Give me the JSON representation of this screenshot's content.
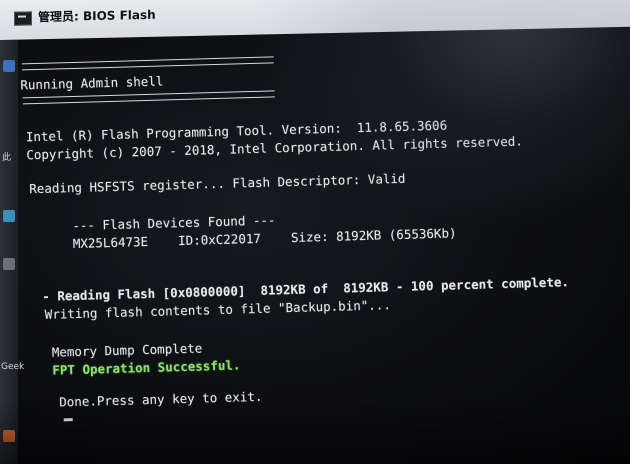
{
  "window": {
    "title": "管理员: BIOS Flash"
  },
  "sidebar": {
    "char_1": "此",
    "label_geek": "Geek"
  },
  "terminal": {
    "header": "Running Admin shell",
    "tool_line": "Intel (R) Flash Programming Tool. Version:  11.8.65.3606",
    "copyright_line": "Copyright (c) 2007 - 2018, Intel Corporation. All rights reserved.",
    "hsfsts_line": "Reading HSFSTS register... Flash Descriptor: Valid",
    "devices_header": "--- Flash Devices Found ---",
    "device_line": "MX25L6473E    ID:0xC22017    Size: 8192KB (65536Kb)",
    "reading_line": "- Reading Flash [0x0800000]  8192KB of  8192KB - 100 percent complete.",
    "writing_line": "Writing flash contents to file \"Backup.bin\"...",
    "dump_line": "Memory Dump Complete",
    "success_line": "FPT Operation Successful.",
    "done_line": "Done.Press any key to exit."
  },
  "colors": {
    "terminal_background": "#0d0e12",
    "terminal_text": "#e7e8ea",
    "success_text": "#88e46a",
    "titlebar": "#e3e5e9"
  },
  "icons": [
    "console-window-icon",
    "blue-app-icon",
    "teal-app-icon",
    "orange-app-icon"
  ]
}
